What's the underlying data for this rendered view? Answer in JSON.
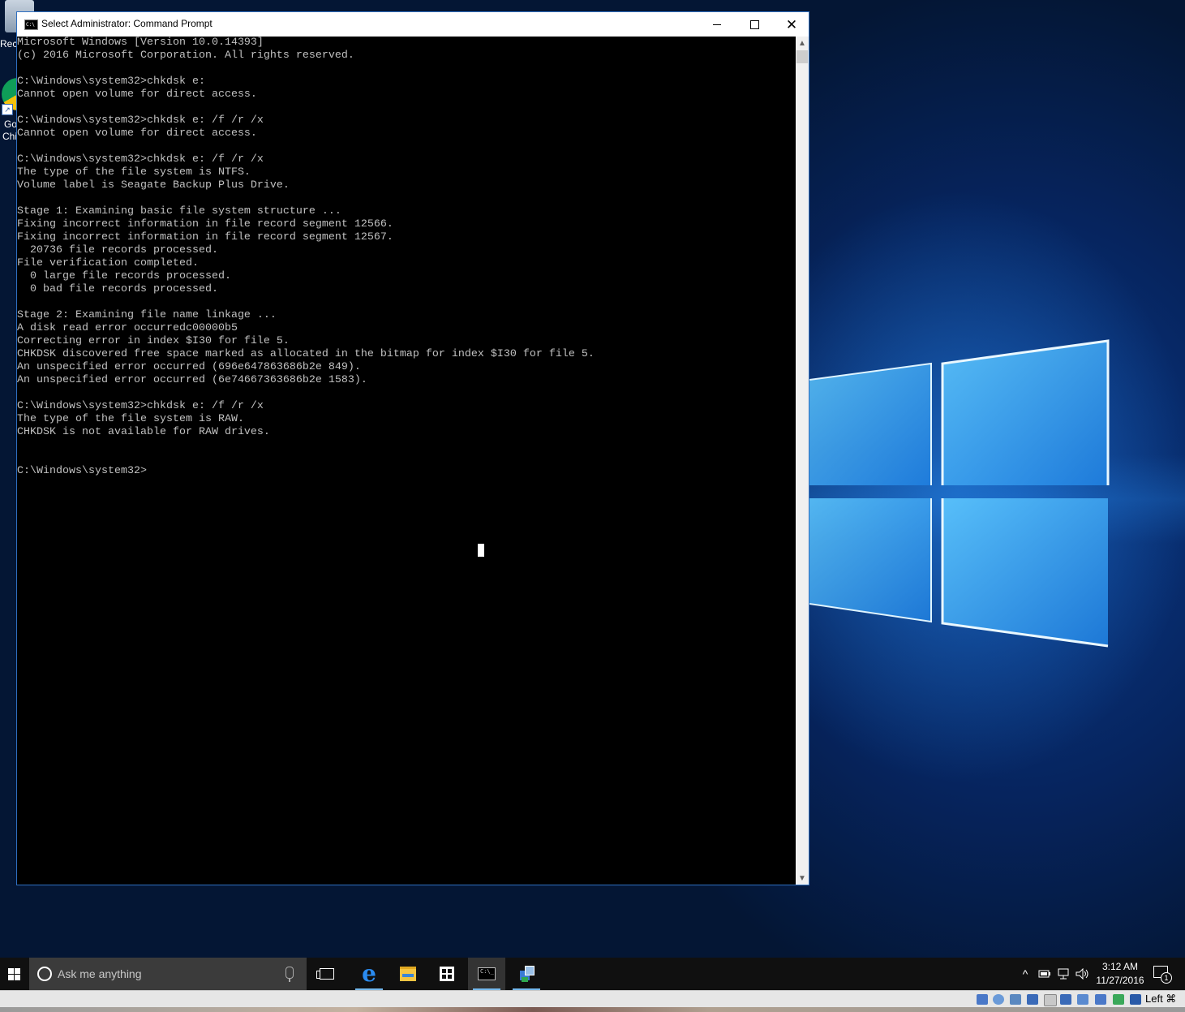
{
  "desktop": {
    "icons": [
      {
        "label": "Recy"
      },
      {
        "label_line1": "Go",
        "label_line2": "Chi"
      }
    ]
  },
  "window": {
    "title": "Select Administrator: Command Prompt",
    "icon_text": "C:\\",
    "controls": {
      "minimize": "minimize",
      "maximize": "maximize",
      "close": "close"
    }
  },
  "console": {
    "lines": [
      "Microsoft Windows [Version 10.0.14393]",
      "(c) 2016 Microsoft Corporation. All rights reserved.",
      "",
      "C:\\Windows\\system32>chkdsk e:",
      "Cannot open volume for direct access.",
      "",
      "C:\\Windows\\system32>chkdsk e: /f /r /x",
      "Cannot open volume for direct access.",
      "",
      "C:\\Windows\\system32>chkdsk e: /f /r /x",
      "The type of the file system is NTFS.",
      "Volume label is Seagate Backup Plus Drive.",
      "",
      "Stage 1: Examining basic file system structure ...",
      "Fixing incorrect information in file record segment 12566.",
      "Fixing incorrect information in file record segment 12567.",
      "  20736 file records processed.",
      "File verification completed.",
      "  0 large file records processed.",
      "  0 bad file records processed.",
      "",
      "Stage 2: Examining file name linkage ...",
      "A disk read error occurredc00000b5",
      "Correcting error in index $I30 for file 5.",
      "CHKDSK discovered free space marked as allocated in the bitmap for index $I30 for file 5.",
      "An unspecified error occurred (696e647863686b2e 849).",
      "An unspecified error occurred (6e74667363686b2e 1583).",
      "",
      "C:\\Windows\\system32>chkdsk e: /f /r /x",
      "The type of the file system is RAW.",
      "CHKDSK is not available for RAW drives.",
      "",
      "",
      "C:\\Windows\\system32>"
    ]
  },
  "taskbar": {
    "search_placeholder": "Ask me anything",
    "apps": [
      "task-view",
      "edge",
      "file-explorer",
      "store",
      "command-prompt",
      "network-tool"
    ],
    "active_app": "command-prompt",
    "tray": {
      "chevron": "^",
      "time": "3:12 AM",
      "date": "11/27/2016",
      "notification_count": "1"
    }
  },
  "hostbar": {
    "key_label": "Left ⌘"
  },
  "colors": {
    "console_bg": "#000000",
    "console_text": "#c0c0c0",
    "taskbar_bg": "#101010",
    "window_border": "#2f6fc0",
    "wallpaper": "#06245e"
  }
}
